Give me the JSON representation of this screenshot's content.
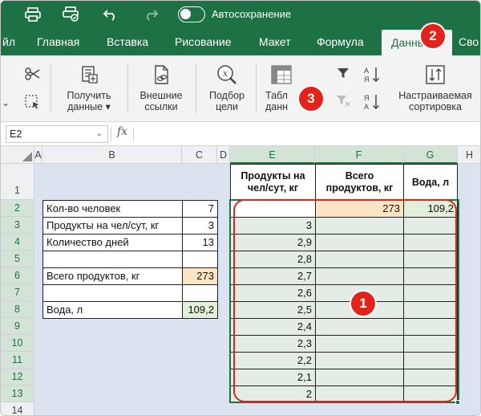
{
  "titlebar": {
    "autosave_label": "Автосохранение",
    "icons": [
      "print-icon",
      "print-preview-icon",
      "undo-icon",
      "redo-icon",
      "toggle-switch"
    ]
  },
  "tabs": [
    {
      "label": "йл"
    },
    {
      "label": "Главная"
    },
    {
      "label": "Вставка"
    },
    {
      "label": "Рисование"
    },
    {
      "label": "Макет"
    },
    {
      "label": "Формула"
    },
    {
      "label": "Данные",
      "active": true
    },
    {
      "label": "Сво"
    }
  ],
  "ribbon": {
    "get_data_line1": "Получить",
    "get_data_line2": "данные ▾",
    "links_line1": "Внешние",
    "links_line2": "ссылки",
    "goal_line1": "Подбор",
    "goal_line2": "цели",
    "table_line1": "Табл",
    "table_line2": "данн",
    "sort_line1": "Настраиваемая",
    "sort_line2": "сортировка"
  },
  "formula_bar": {
    "name_box": "E2",
    "fx_label": "fx",
    "value": ""
  },
  "columns": [
    "A",
    "B",
    "C",
    "D",
    "E",
    "F",
    "G",
    "H"
  ],
  "rows": [
    "1",
    "2",
    "3",
    "4",
    "5",
    "6",
    "7",
    "8",
    "9",
    "10",
    "11",
    "12",
    "13",
    "14"
  ],
  "left_table": {
    "labels": [
      "Кол-во человек",
      "Продукты на чел/сут, кг",
      "Количество дней",
      "",
      "Всего продуктов, кг",
      "",
      "Вода, л"
    ],
    "values": [
      "7",
      "3",
      "13",
      "",
      "273",
      "",
      "109,2"
    ]
  },
  "right_table": {
    "headers": [
      "Продукты на чел/сут, кг",
      "Всего продуктов, кг",
      "Вода, л"
    ],
    "row2": [
      "",
      "273",
      "109,2"
    ],
    "e_values": [
      "3",
      "2,9",
      "2,8",
      "2,7",
      "2,6",
      "2,5",
      "2,4",
      "2,3",
      "2,2",
      "2,1",
      "2"
    ]
  },
  "badges": [
    "1",
    "2",
    "3"
  ],
  "colors": {
    "excel_green": "#1e7145",
    "annotation_red": "#e2231a",
    "highlight_orange": "#fce4c4",
    "highlight_green": "#e2efda"
  }
}
